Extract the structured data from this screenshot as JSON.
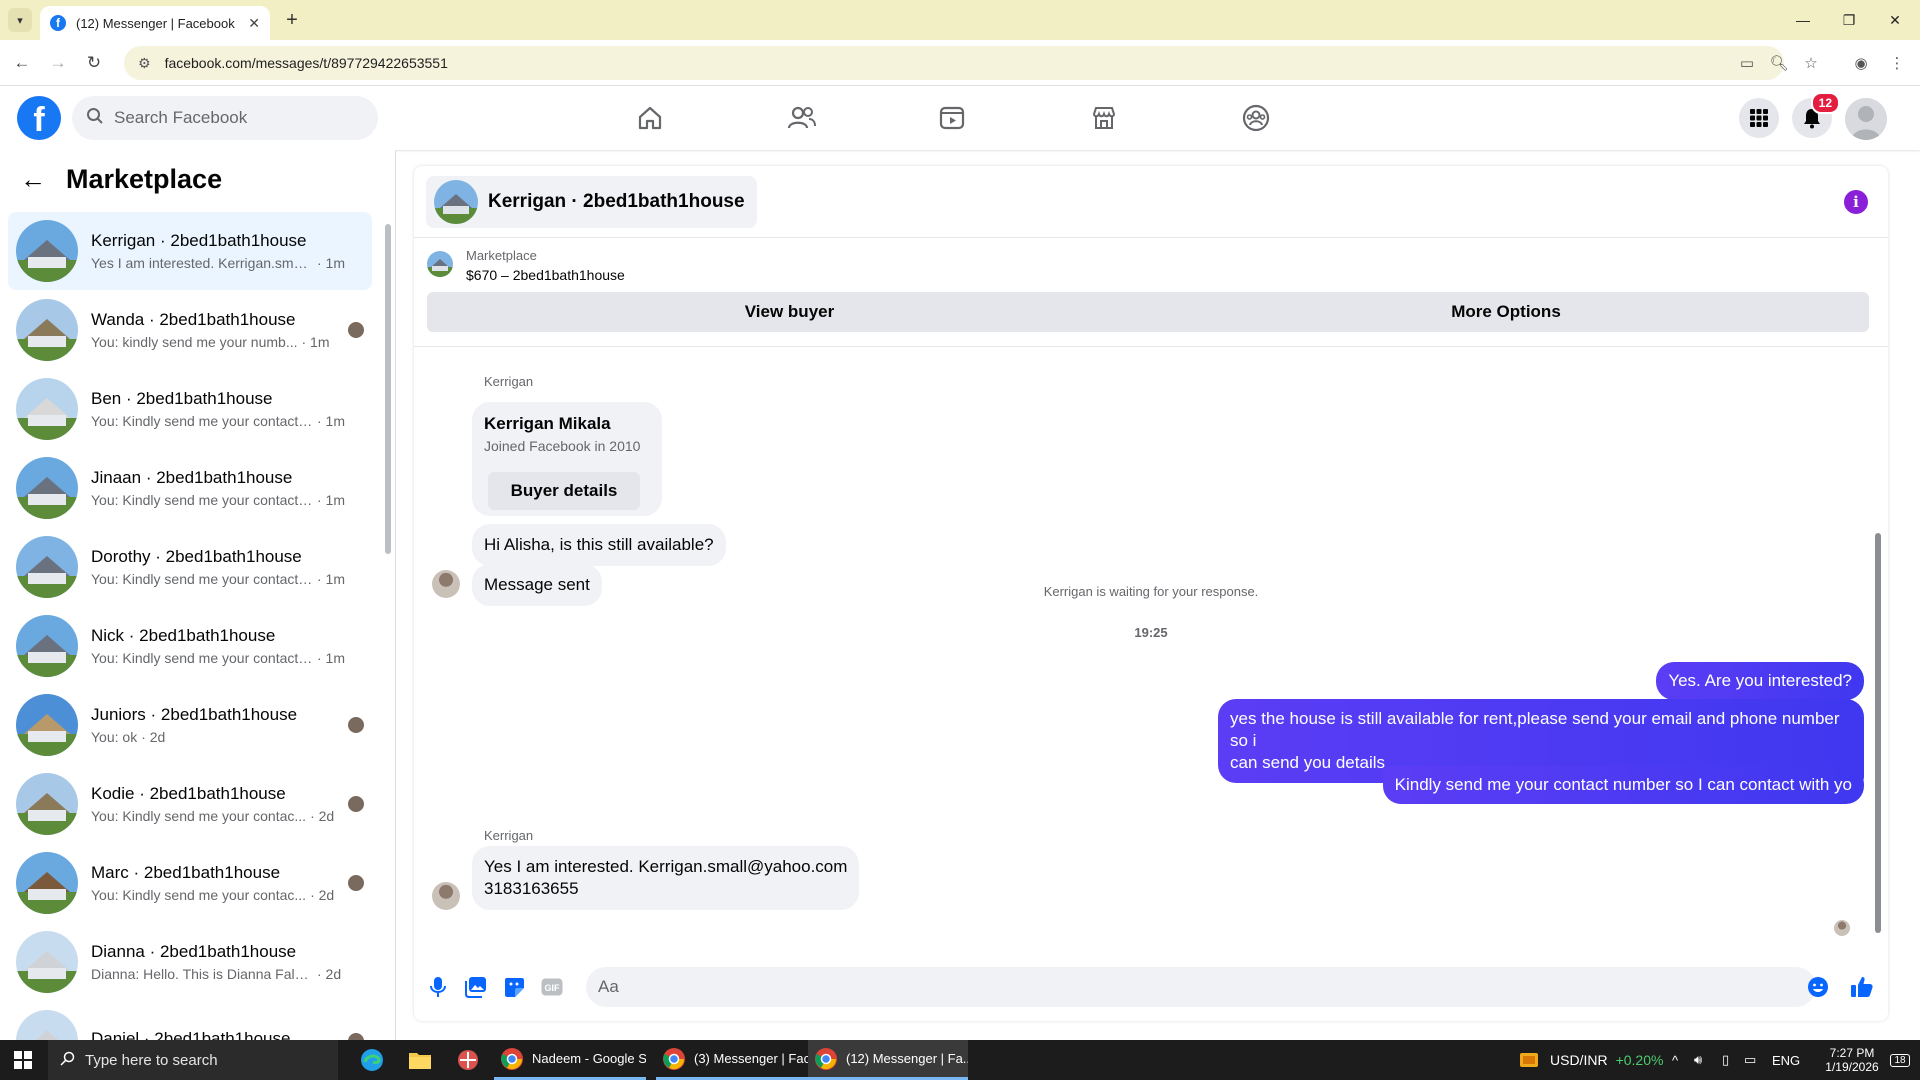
{
  "browser": {
    "tab_title": "(12) Messenger | Facebook",
    "url": "facebook.com/messages/t/897729422653551"
  },
  "fb": {
    "search_placeholder": "Search Facebook",
    "notification_count": "12"
  },
  "sidebar": {
    "title": "Marketplace",
    "conversations": [
      {
        "name": "Kerrigan · 2bed1bath1house",
        "preview": "Yes I am interested. Kerrigan.small...",
        "time": "· 1m"
      },
      {
        "name": "Wanda · 2bed1bath1house",
        "preview": "You: kindly send me your numb...",
        "time": "· 1m"
      },
      {
        "name": "Ben · 2bed1bath1house",
        "preview": "You: Kindly send me your contact ...",
        "time": "· 1m"
      },
      {
        "name": "Jinaan · 2bed1bath1house",
        "preview": "You: Kindly send me your contact ...",
        "time": "· 1m"
      },
      {
        "name": "Dorothy · 2bed1bath1house",
        "preview": "You: Kindly send me your contact ...",
        "time": "· 1m"
      },
      {
        "name": "Nick · 2bed1bath1house",
        "preview": "You: Kindly send me your contact ...",
        "time": "· 1m"
      },
      {
        "name": "Juniors · 2bed1bath1house",
        "preview": "You: ok",
        "time": "· 2d"
      },
      {
        "name": "Kodie · 2bed1bath1house",
        "preview": "You: Kindly send me your contac...",
        "time": "· 2d"
      },
      {
        "name": "Marc · 2bed1bath1house",
        "preview": "You: Kindly send me your contac...",
        "time": "· 2d"
      },
      {
        "name": "Dianna · 2bed1bath1house",
        "preview": "Dianna: Hello. This is Dianna Falson...",
        "time": "· 2d"
      },
      {
        "name": "Daniel · 2bed1bath1house",
        "preview": "",
        "time": ""
      }
    ]
  },
  "chat": {
    "title": "Kerrigan · 2bed1bath1house",
    "listing_label": "Marketplace",
    "listing_price": "$670 – 2bed1bath1house",
    "view_buyer": "View buyer",
    "more_options": "More Options",
    "sender_name": "Kerrigan",
    "card_name": "Kerrigan Mikala",
    "card_joined": "Joined Facebook in 2010",
    "card_button": "Buyer details",
    "msg_1": "Hi Alisha, is this still available?",
    "msg_2": "Message sent",
    "waiting_notice": "Kerrigan is waiting for your response.",
    "timestamp": "19:25",
    "out_1": "Yes. Are you interested?",
    "out_2a": "yes the house is still available for rent,please send your email and phone number so i",
    "out_2b": "can send you details",
    "out_3": "Kindly send me your contact number so I can contact with yo",
    "reply_sender": "Kerrigan",
    "reply_line1": "Yes I am interested. Kerrigan.small@yahoo.com",
    "reply_line2": "3183163655",
    "input_placeholder": "Aa"
  },
  "taskbar": {
    "search_placeholder": "Type here to search",
    "apps": [
      {
        "label": "Nadeem - Google S..."
      },
      {
        "label": "(3) Messenger | Fac..."
      },
      {
        "label": "(12) Messenger | Fa..."
      }
    ],
    "ticker_label": "USD/INR",
    "ticker_change": "+0.20%",
    "language": "ENG",
    "time": "7:27 PM",
    "date": "1/19/2026",
    "notif_count": "18"
  },
  "colors": {
    "fb_blue": "#1877f2",
    "outgoing_bubble": "#4d2ef0",
    "info_purple": "#8a1fd9",
    "notif_red": "#e41e3f",
    "ticker_green": "#4ccc6e"
  }
}
